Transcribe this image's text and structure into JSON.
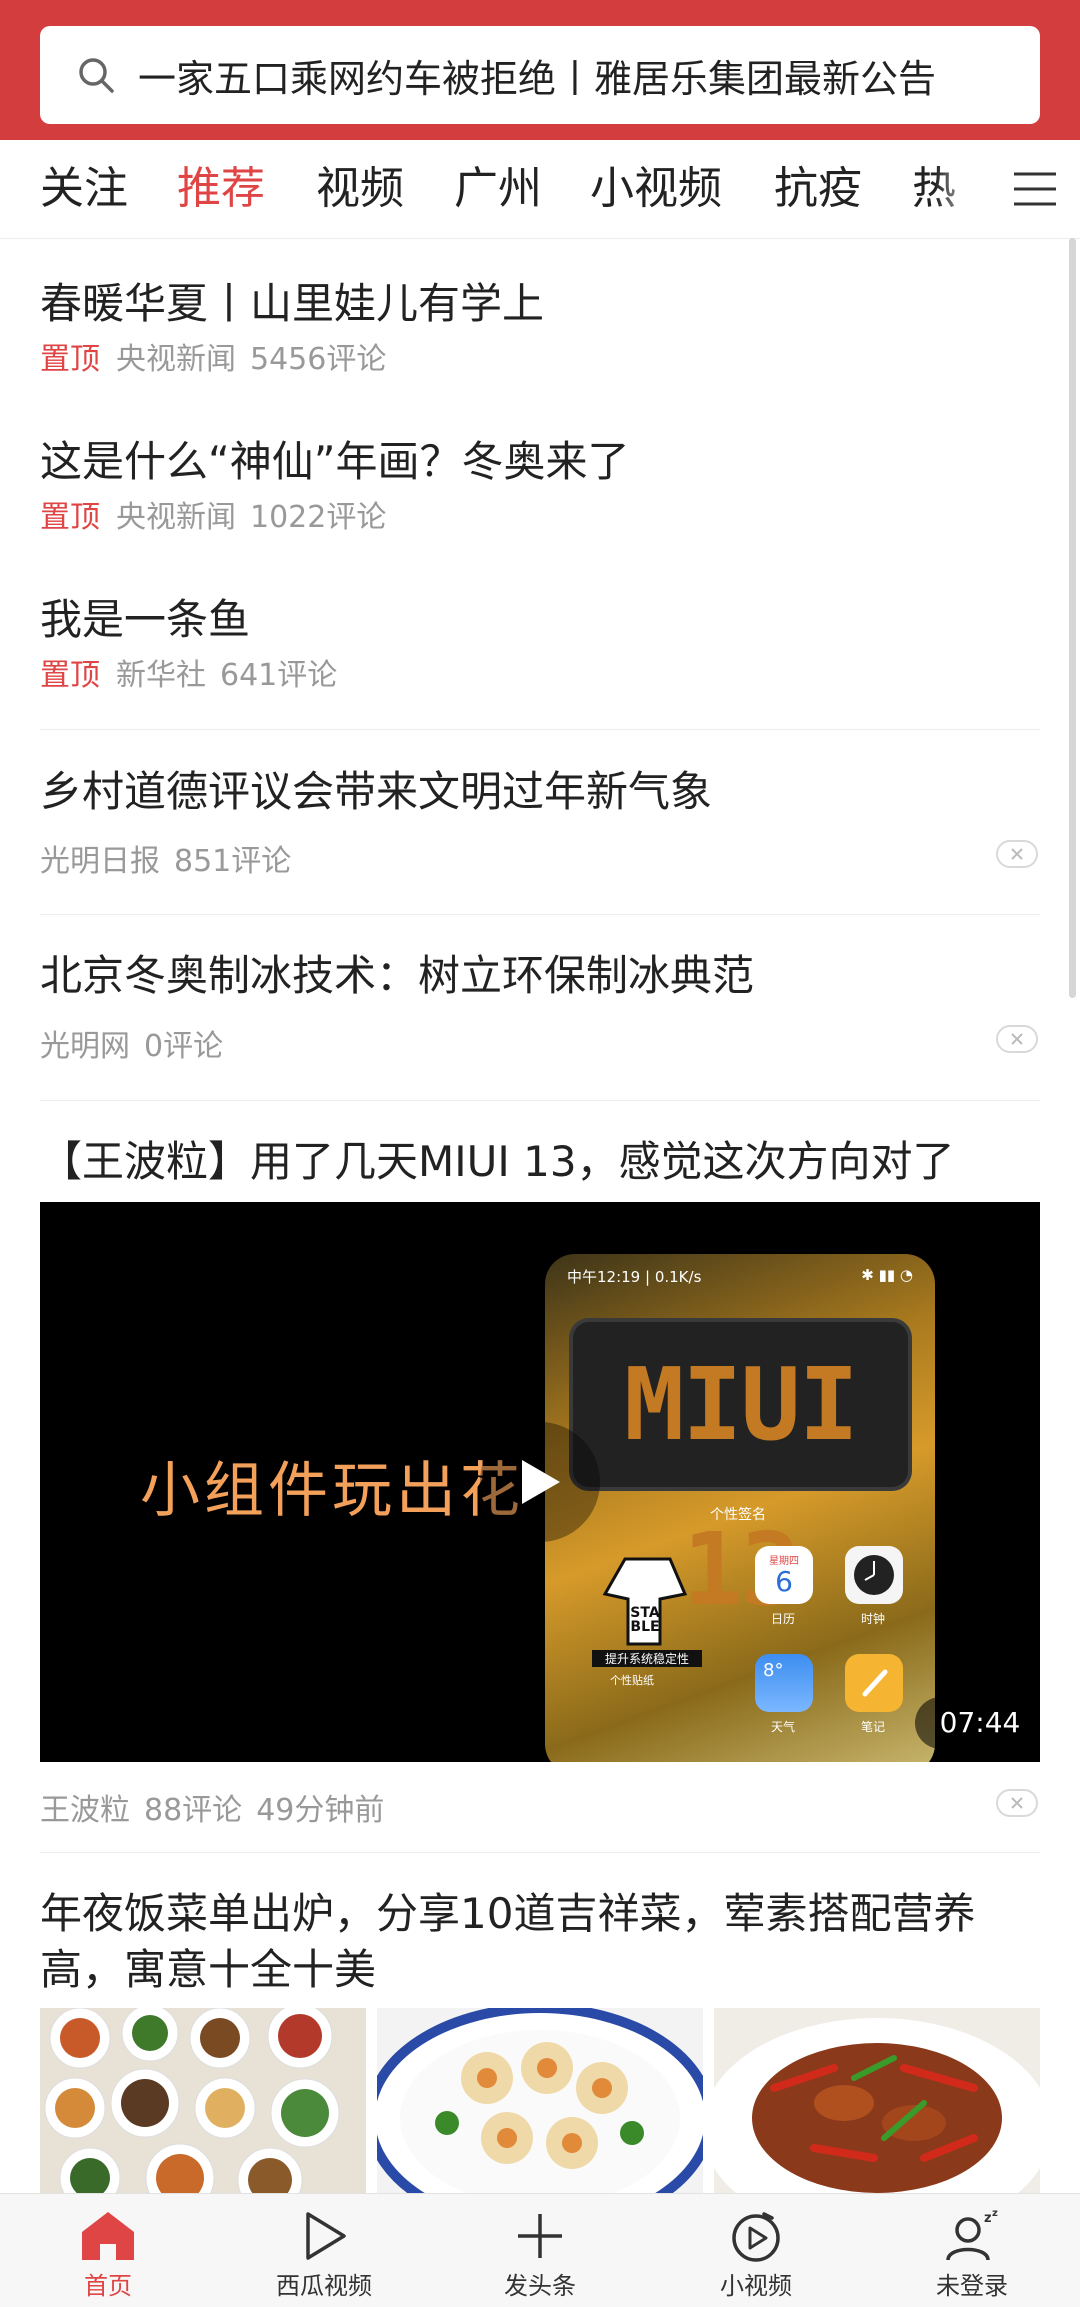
{
  "search": {
    "placeholder": "一家五口乘网约车被拒绝丨雅居乐集团最新公告"
  },
  "tabs": [
    {
      "label": "关注"
    },
    {
      "label": "推荐",
      "active": true
    },
    {
      "label": "视频"
    },
    {
      "label": "广州"
    },
    {
      "label": "小视频"
    },
    {
      "label": "抗疫"
    },
    {
      "label": "热"
    }
  ],
  "feed": {
    "pinned": [
      {
        "title": "春暖华夏丨山里娃儿有学上",
        "tag": "置顶",
        "source": "央视新闻",
        "comments": "5456评论"
      },
      {
        "title": "这是什么“神仙”年画？冬奥来了",
        "tag": "置顶",
        "source": "央视新闻",
        "comments": "1022评论"
      },
      {
        "title": "我是一条鱼",
        "tag": "置顶",
        "source": "新华社",
        "comments": "641评论"
      }
    ],
    "articles": [
      {
        "title": "乡村道德评议会带来文明过年新气象",
        "source": "光明日报",
        "comments": "851评论"
      },
      {
        "title": "北京冬奥制冰技术：树立环保制冰典范",
        "source": "光明网",
        "comments": "0评论"
      }
    ],
    "video": {
      "title": "【王波粒】用了几天MIUI 13，感觉这次方向对了",
      "caption": "小组件玩出花",
      "phone_time": "中午12:19 | 0.1K/s",
      "phone_widget_text": "MIUI 13",
      "phone_widget_label": "个性签名",
      "app_calendar_day": "星期四",
      "app_calendar_date": "6",
      "app_calendar_label": "日历",
      "app_clock_label": "时钟",
      "app_weather_temp": "8°",
      "app_weather_label": "天气",
      "app_notes_label": "笔记",
      "sticker_text": "STA BLE",
      "sticker_caption": "提升系统稳定性",
      "sticker_label": "个性贴纸",
      "duration": "07:44",
      "source": "王波粒",
      "comments": "88评论",
      "time": "49分钟前"
    },
    "food_article": {
      "title_line1": "年夜饭菜单出炉，分享10道吉祥菜，荤素搭配营养",
      "title_line2": "高，寓意十全十美"
    }
  },
  "bottom_nav": [
    {
      "label": "首页",
      "icon": "home-icon",
      "active": true
    },
    {
      "label": "西瓜视频",
      "icon": "play-outline-icon"
    },
    {
      "label": "发头条",
      "icon": "plus-icon"
    },
    {
      "label": "小视频",
      "icon": "short-video-icon"
    },
    {
      "label": "未登录",
      "icon": "user-sleep-icon"
    }
  ],
  "colors": {
    "brand_red": "#d43d3d",
    "active_tab": "#e04545",
    "meta_gray": "#999999"
  }
}
